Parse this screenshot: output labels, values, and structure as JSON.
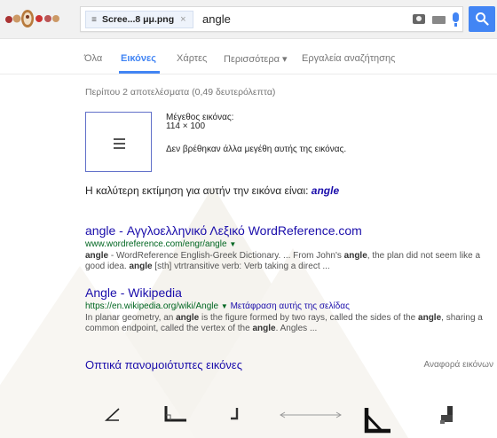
{
  "search": {
    "chip_label": "Scree...8 μμ.png",
    "chip_close": "×",
    "query": "angle"
  },
  "tabs": [
    {
      "label": "Όλα"
    },
    {
      "label": "Εικόνες"
    },
    {
      "label": "Χάρτες"
    },
    {
      "label": "Περισσότερα ▾"
    },
    {
      "label": "Εργαλεία αναζήτησης"
    }
  ],
  "stats": "Περίπου 2 αποτελέσματα (0,49 δευτερόλεπτα)",
  "image_info": {
    "size_label": "Μέγεθος εικόνας:",
    "size_value": "114 × 100",
    "no_other_sizes": "Δεν βρέθηκαν άλλα μεγέθη αυτής της εικόνας."
  },
  "best_guess": {
    "prefix": "Η καλύτερη εκτίμηση για αυτήν την εικόνα είναι:",
    "term": "angle"
  },
  "results": [
    {
      "title": "angle - Αγγλοελληνικό Λεξικό WordReference.com",
      "url": "www.wordreference.com/engr/angle",
      "translate": "",
      "snippet": "angle - WordReference English-Greek Dictionary. ... From John's angle, the plan did not seem like a good idea. angle [sth] vtrtransitive verb: Verb taking a direct ..."
    },
    {
      "title": "Angle - Wikipedia",
      "url": "https://en.wikipedia.org/wiki/Angle",
      "translate": "Μετάφραση αυτής της σελίδας",
      "snippet": "In planar geometry, an angle is the figure formed by two rays, called the sides of the angle, sharing a common endpoint, called the vertex of the angle. Angles ..."
    }
  ],
  "similar": {
    "title": "Οπτικά πανομοιότυπες εικόνες",
    "report": "Αναφορά εικόνων"
  },
  "colors": {
    "accent": "#4285f4",
    "link": "#1a0dab",
    "url": "#006621"
  }
}
